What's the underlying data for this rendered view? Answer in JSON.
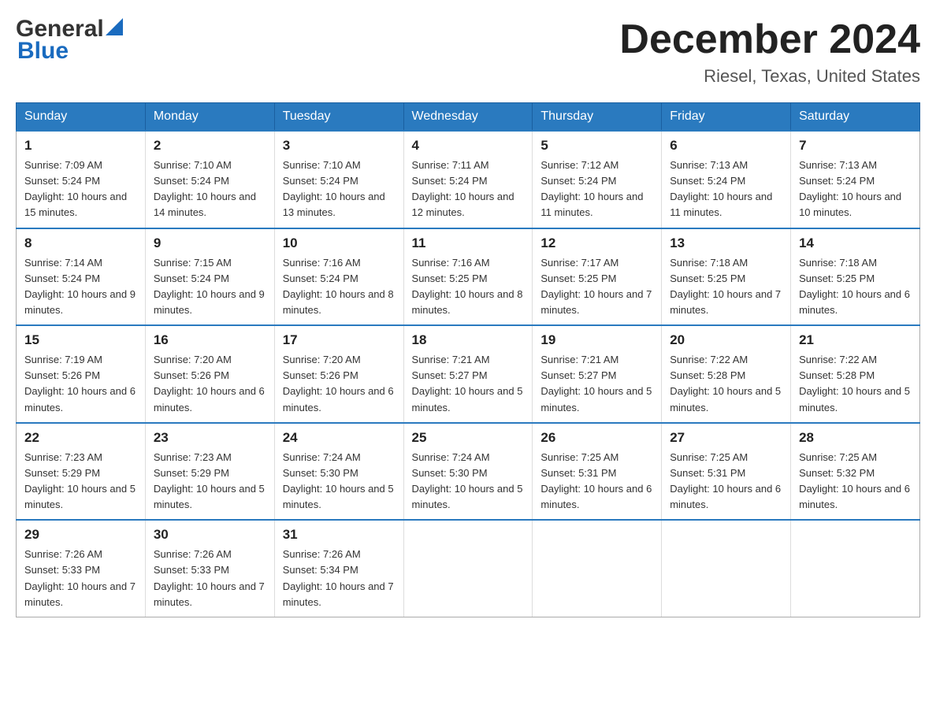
{
  "header": {
    "logo_general": "General",
    "logo_blue": "Blue",
    "month_title": "December 2024",
    "location": "Riesel, Texas, United States"
  },
  "weekdays": [
    "Sunday",
    "Monday",
    "Tuesday",
    "Wednesday",
    "Thursday",
    "Friday",
    "Saturday"
  ],
  "weeks": [
    [
      {
        "day": "1",
        "sunrise": "Sunrise: 7:09 AM",
        "sunset": "Sunset: 5:24 PM",
        "daylight": "Daylight: 10 hours and 15 minutes."
      },
      {
        "day": "2",
        "sunrise": "Sunrise: 7:10 AM",
        "sunset": "Sunset: 5:24 PM",
        "daylight": "Daylight: 10 hours and 14 minutes."
      },
      {
        "day": "3",
        "sunrise": "Sunrise: 7:10 AM",
        "sunset": "Sunset: 5:24 PM",
        "daylight": "Daylight: 10 hours and 13 minutes."
      },
      {
        "day": "4",
        "sunrise": "Sunrise: 7:11 AM",
        "sunset": "Sunset: 5:24 PM",
        "daylight": "Daylight: 10 hours and 12 minutes."
      },
      {
        "day": "5",
        "sunrise": "Sunrise: 7:12 AM",
        "sunset": "Sunset: 5:24 PM",
        "daylight": "Daylight: 10 hours and 11 minutes."
      },
      {
        "day": "6",
        "sunrise": "Sunrise: 7:13 AM",
        "sunset": "Sunset: 5:24 PM",
        "daylight": "Daylight: 10 hours and 11 minutes."
      },
      {
        "day": "7",
        "sunrise": "Sunrise: 7:13 AM",
        "sunset": "Sunset: 5:24 PM",
        "daylight": "Daylight: 10 hours and 10 minutes."
      }
    ],
    [
      {
        "day": "8",
        "sunrise": "Sunrise: 7:14 AM",
        "sunset": "Sunset: 5:24 PM",
        "daylight": "Daylight: 10 hours and 9 minutes."
      },
      {
        "day": "9",
        "sunrise": "Sunrise: 7:15 AM",
        "sunset": "Sunset: 5:24 PM",
        "daylight": "Daylight: 10 hours and 9 minutes."
      },
      {
        "day": "10",
        "sunrise": "Sunrise: 7:16 AM",
        "sunset": "Sunset: 5:24 PM",
        "daylight": "Daylight: 10 hours and 8 minutes."
      },
      {
        "day": "11",
        "sunrise": "Sunrise: 7:16 AM",
        "sunset": "Sunset: 5:25 PM",
        "daylight": "Daylight: 10 hours and 8 minutes."
      },
      {
        "day": "12",
        "sunrise": "Sunrise: 7:17 AM",
        "sunset": "Sunset: 5:25 PM",
        "daylight": "Daylight: 10 hours and 7 minutes."
      },
      {
        "day": "13",
        "sunrise": "Sunrise: 7:18 AM",
        "sunset": "Sunset: 5:25 PM",
        "daylight": "Daylight: 10 hours and 7 minutes."
      },
      {
        "day": "14",
        "sunrise": "Sunrise: 7:18 AM",
        "sunset": "Sunset: 5:25 PM",
        "daylight": "Daylight: 10 hours and 6 minutes."
      }
    ],
    [
      {
        "day": "15",
        "sunrise": "Sunrise: 7:19 AM",
        "sunset": "Sunset: 5:26 PM",
        "daylight": "Daylight: 10 hours and 6 minutes."
      },
      {
        "day": "16",
        "sunrise": "Sunrise: 7:20 AM",
        "sunset": "Sunset: 5:26 PM",
        "daylight": "Daylight: 10 hours and 6 minutes."
      },
      {
        "day": "17",
        "sunrise": "Sunrise: 7:20 AM",
        "sunset": "Sunset: 5:26 PM",
        "daylight": "Daylight: 10 hours and 6 minutes."
      },
      {
        "day": "18",
        "sunrise": "Sunrise: 7:21 AM",
        "sunset": "Sunset: 5:27 PM",
        "daylight": "Daylight: 10 hours and 5 minutes."
      },
      {
        "day": "19",
        "sunrise": "Sunrise: 7:21 AM",
        "sunset": "Sunset: 5:27 PM",
        "daylight": "Daylight: 10 hours and 5 minutes."
      },
      {
        "day": "20",
        "sunrise": "Sunrise: 7:22 AM",
        "sunset": "Sunset: 5:28 PM",
        "daylight": "Daylight: 10 hours and 5 minutes."
      },
      {
        "day": "21",
        "sunrise": "Sunrise: 7:22 AM",
        "sunset": "Sunset: 5:28 PM",
        "daylight": "Daylight: 10 hours and 5 minutes."
      }
    ],
    [
      {
        "day": "22",
        "sunrise": "Sunrise: 7:23 AM",
        "sunset": "Sunset: 5:29 PM",
        "daylight": "Daylight: 10 hours and 5 minutes."
      },
      {
        "day": "23",
        "sunrise": "Sunrise: 7:23 AM",
        "sunset": "Sunset: 5:29 PM",
        "daylight": "Daylight: 10 hours and 5 minutes."
      },
      {
        "day": "24",
        "sunrise": "Sunrise: 7:24 AM",
        "sunset": "Sunset: 5:30 PM",
        "daylight": "Daylight: 10 hours and 5 minutes."
      },
      {
        "day": "25",
        "sunrise": "Sunrise: 7:24 AM",
        "sunset": "Sunset: 5:30 PM",
        "daylight": "Daylight: 10 hours and 5 minutes."
      },
      {
        "day": "26",
        "sunrise": "Sunrise: 7:25 AM",
        "sunset": "Sunset: 5:31 PM",
        "daylight": "Daylight: 10 hours and 6 minutes."
      },
      {
        "day": "27",
        "sunrise": "Sunrise: 7:25 AM",
        "sunset": "Sunset: 5:31 PM",
        "daylight": "Daylight: 10 hours and 6 minutes."
      },
      {
        "day": "28",
        "sunrise": "Sunrise: 7:25 AM",
        "sunset": "Sunset: 5:32 PM",
        "daylight": "Daylight: 10 hours and 6 minutes."
      }
    ],
    [
      {
        "day": "29",
        "sunrise": "Sunrise: 7:26 AM",
        "sunset": "Sunset: 5:33 PM",
        "daylight": "Daylight: 10 hours and 7 minutes."
      },
      {
        "day": "30",
        "sunrise": "Sunrise: 7:26 AM",
        "sunset": "Sunset: 5:33 PM",
        "daylight": "Daylight: 10 hours and 7 minutes."
      },
      {
        "day": "31",
        "sunrise": "Sunrise: 7:26 AM",
        "sunset": "Sunset: 5:34 PM",
        "daylight": "Daylight: 10 hours and 7 minutes."
      },
      null,
      null,
      null,
      null
    ]
  ]
}
